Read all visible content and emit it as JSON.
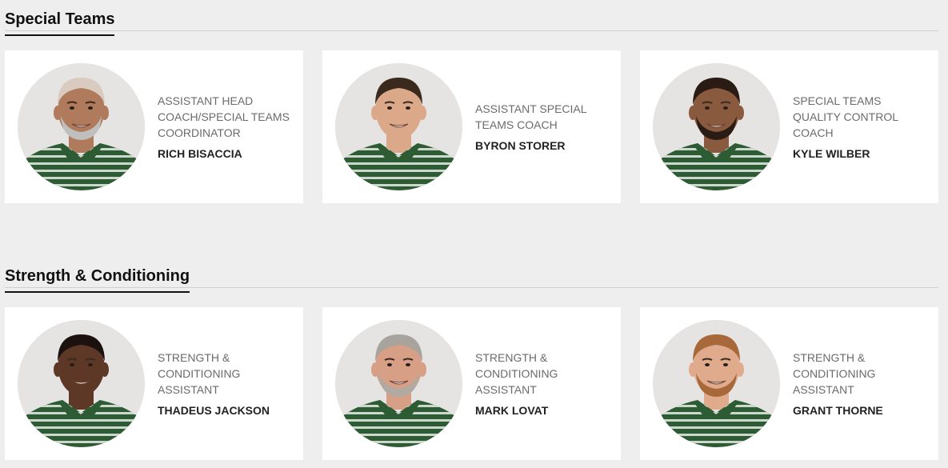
{
  "sections": [
    {
      "title": "Special Teams",
      "coaches": [
        {
          "title": "ASSISTANT HEAD COACH/SPECIAL TEAMS COORDINATOR",
          "name": "RICH BISACCIA",
          "skin": "#b07a5c",
          "hair": "#d9cbbf",
          "beard": "#bfbfbf"
        },
        {
          "title": "ASSISTANT SPECIAL TEAMS COACH",
          "name": "BYRON STORER",
          "skin": "#dba98a",
          "hair": "#3a2a1e",
          "beard": "none"
        },
        {
          "title": "SPECIAL TEAMS QUALITY CONTROL COACH",
          "name": "KYLE WILBER",
          "skin": "#8a5a3e",
          "hair": "#2a1c14",
          "beard": "#2a1c14"
        }
      ]
    },
    {
      "title": "Strength & Conditioning",
      "coaches": [
        {
          "title": "STRENGTH & CONDITIONING ASSISTANT",
          "name": "THADEUS JACKSON",
          "skin": "#5e3826",
          "hair": "#1b1210",
          "beard": "none"
        },
        {
          "title": "STRENGTH & CONDITIONING ASSISTANT",
          "name": "MARK LOVAT",
          "skin": "#d79f86",
          "hair": "#a8a39c",
          "beard": "#b0aaa3"
        },
        {
          "title": "STRENGTH & CONDITIONING ASSISTANT",
          "name": "GRANT THORNE",
          "skin": "#e0ab8d",
          "hair": "#a8693a",
          "beard": "#a8693a"
        }
      ]
    }
  ],
  "colors": {
    "page_background": "#eeeeee",
    "card_background": "#ffffff",
    "jersey_green": "#2d5b34",
    "jersey_stripe": "#e9efe8"
  },
  "icons": {
    "coach_photo": "coach-headshot"
  }
}
